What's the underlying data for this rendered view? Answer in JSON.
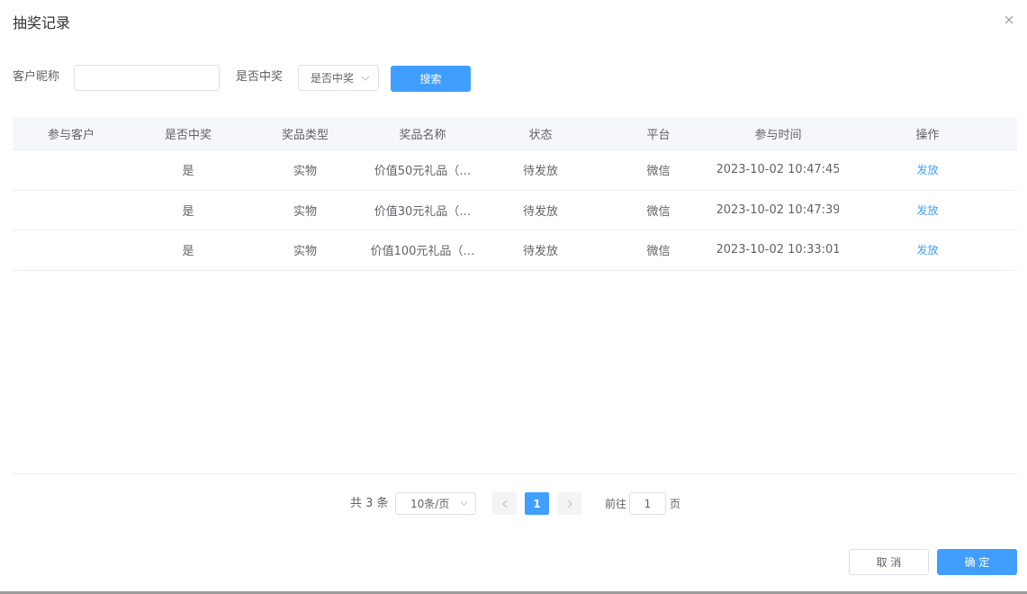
{
  "dialog": {
    "title": "抽奖记录"
  },
  "filters": {
    "nickname_label": "客户昵称",
    "nickname_value": "",
    "nickname_placeholder": "",
    "won_label": "是否中奖",
    "won_select_value": "是否中奖",
    "search_label": "搜索"
  },
  "table": {
    "headers": [
      "参与客户",
      "是否中奖",
      "奖品类型",
      "奖品名称",
      "状态",
      "平台",
      "参与时间",
      "操作"
    ],
    "rows": [
      {
        "customer": "",
        "won": "是",
        "prize_type": "实物",
        "prize_name": "价值50元礼品（…",
        "status": "待发放",
        "platform": "微信",
        "time": "2023-10-02 10:47:45",
        "action": "发放"
      },
      {
        "customer": "",
        "won": "是",
        "prize_type": "实物",
        "prize_name": "价值30元礼品（…",
        "status": "待发放",
        "platform": "微信",
        "time": "2023-10-02 10:47:39",
        "action": "发放"
      },
      {
        "customer": "",
        "won": "是",
        "prize_type": "实物",
        "prize_name": "价值100元礼品（…",
        "status": "待发放",
        "platform": "微信",
        "time": "2023-10-02 10:33:01",
        "action": "发放"
      }
    ]
  },
  "pagination": {
    "total_text": "共 3 条",
    "page_size": "10条/页",
    "current_page": "1",
    "goto_prefix": "前往",
    "goto_value": "1",
    "goto_suffix": "页"
  },
  "footer": {
    "cancel_label": "取 消",
    "ok_label": "确 定"
  },
  "colors": {
    "primary": "#409eff",
    "text": "#606266",
    "border": "#dcdfe6",
    "header_bg": "#f5f7fa"
  }
}
